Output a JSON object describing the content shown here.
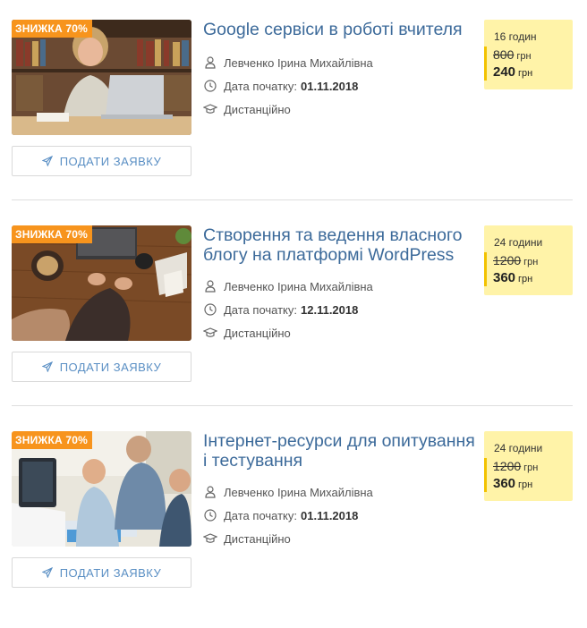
{
  "courses": [
    {
      "badge": "ЗНИЖКА 70%",
      "title": "Google сервіси в роботі вчителя",
      "author": "Левченко Ірина Михайлівна",
      "start_label": "Дата початку:",
      "start_date": "01.11.2018",
      "format": "Дистанційно",
      "hours": "16 годин",
      "old_price": "800",
      "new_price": "240",
      "currency": "грн",
      "button": "ПОДАТИ ЗАЯВКУ"
    },
    {
      "badge": "ЗНИЖКА 70%",
      "title": "Створення та ведення власного блогу на платформі WordPress",
      "author": "Левченко Ірина Михайлівна",
      "start_label": "Дата початку:",
      "start_date": "12.11.2018",
      "format": "Дистанційно",
      "hours": "24 години",
      "old_price": "1200",
      "new_price": "360",
      "currency": "грн",
      "button": "ПОДАТИ ЗАЯВКУ"
    },
    {
      "badge": "ЗНИЖКА 70%",
      "title": "Інтернет-ресурси для опитування і тестування",
      "author": "Левченко Ірина Михайлівна",
      "start_label": "Дата початку:",
      "start_date": "01.11.2018",
      "format": "Дистанційно",
      "hours": "24 години",
      "old_price": "1200",
      "new_price": "360",
      "currency": "грн",
      "button": "ПОДАТИ ЗАЯВКУ"
    }
  ],
  "colors": {
    "badge": "#f7941d",
    "title": "#3c6a9a",
    "price_bg": "#fff3a8",
    "price_bar": "#f2c200",
    "button_text": "#5a8fc4"
  },
  "icons": {
    "author": "user-icon",
    "date": "clock-icon",
    "format": "graduation-cap-icon",
    "button": "paper-plane-icon"
  }
}
